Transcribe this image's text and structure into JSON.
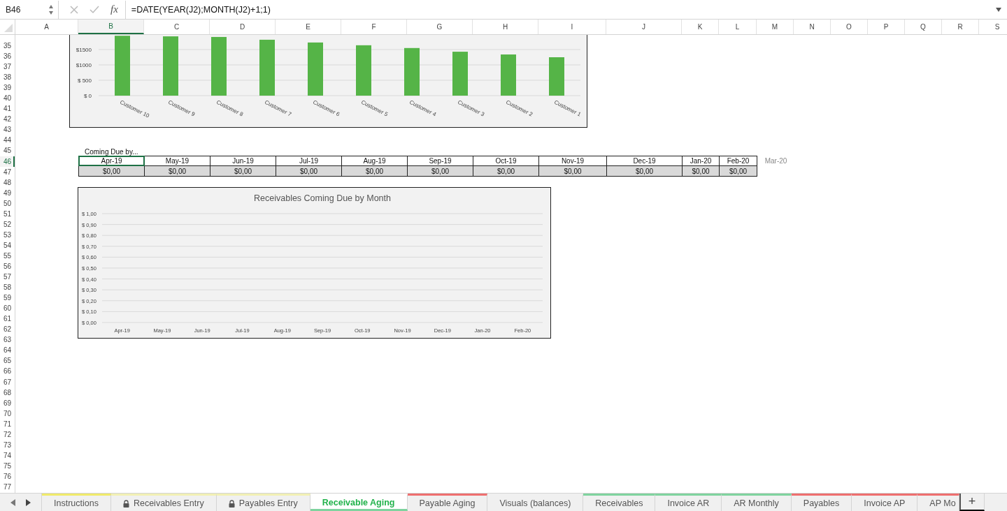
{
  "formula_bar": {
    "name_box": "B46",
    "function_label": "fx",
    "formula": "=DATE(YEAR(J2);MONTH(J2)+1;1)"
  },
  "columns": [
    {
      "label": "A",
      "selected": false
    },
    {
      "label": "B",
      "selected": true
    },
    {
      "label": "C",
      "selected": false
    },
    {
      "label": "D",
      "selected": false
    },
    {
      "label": "E",
      "selected": false
    },
    {
      "label": "F",
      "selected": false
    },
    {
      "label": "G",
      "selected": false
    },
    {
      "label": "H",
      "selected": false
    },
    {
      "label": "I",
      "selected": false
    },
    {
      "label": "J",
      "selected": false
    },
    {
      "label": "K",
      "selected": false
    },
    {
      "label": "L",
      "selected": false
    },
    {
      "label": "M",
      "selected": false
    },
    {
      "label": "N",
      "selected": false
    },
    {
      "label": "O",
      "selected": false
    },
    {
      "label": "P",
      "selected": false
    },
    {
      "label": "Q",
      "selected": false
    },
    {
      "label": "R",
      "selected": false
    },
    {
      "label": "S",
      "selected": false
    }
  ],
  "rows": [
    {
      "label": "35",
      "selected": false
    },
    {
      "label": "36",
      "selected": false
    },
    {
      "label": "37",
      "selected": false
    },
    {
      "label": "38",
      "selected": false
    },
    {
      "label": "39",
      "selected": false
    },
    {
      "label": "40",
      "selected": false
    },
    {
      "label": "41",
      "selected": false
    },
    {
      "label": "42",
      "selected": false
    },
    {
      "label": "43",
      "selected": false
    },
    {
      "label": "44",
      "selected": false
    },
    {
      "label": "45",
      "selected": false
    },
    {
      "label": "46",
      "selected": true
    },
    {
      "label": "47",
      "selected": false
    },
    {
      "label": "48",
      "selected": false
    },
    {
      "label": "49",
      "selected": false
    },
    {
      "label": "50",
      "selected": false
    },
    {
      "label": "51",
      "selected": false
    },
    {
      "label": "52",
      "selected": false
    },
    {
      "label": "53",
      "selected": false
    },
    {
      "label": "54",
      "selected": false
    },
    {
      "label": "55",
      "selected": false
    },
    {
      "label": "56",
      "selected": false
    },
    {
      "label": "57",
      "selected": false
    },
    {
      "label": "58",
      "selected": false
    },
    {
      "label": "59",
      "selected": false
    },
    {
      "label": "60",
      "selected": false
    },
    {
      "label": "61",
      "selected": false
    },
    {
      "label": "62",
      "selected": false
    },
    {
      "label": "63",
      "selected": false
    },
    {
      "label": "64",
      "selected": false
    },
    {
      "label": "65",
      "selected": false
    },
    {
      "label": "66",
      "selected": false
    },
    {
      "label": "67",
      "selected": false
    },
    {
      "label": "68",
      "selected": false
    },
    {
      "label": "69",
      "selected": false
    },
    {
      "label": "70",
      "selected": false
    },
    {
      "label": "71",
      "selected": false
    },
    {
      "label": "72",
      "selected": false
    },
    {
      "label": "73",
      "selected": false
    },
    {
      "label": "74",
      "selected": false
    },
    {
      "label": "75",
      "selected": false
    },
    {
      "label": "76",
      "selected": false
    },
    {
      "label": "77",
      "selected": false
    }
  ],
  "balance_chart": {
    "chart_data": {
      "type": "bar",
      "categories": [
        "Customer 10",
        "Customer 9",
        "Customer 8",
        "Customer 7",
        "Customer 6",
        "Customer 5",
        "Customer 4",
        "Customer 3",
        "Customer 2",
        "Customer 1"
      ],
      "values": [
        1950,
        1930,
        1910,
        1820,
        1730,
        1640,
        1550,
        1430,
        1340,
        1250
      ],
      "ylim": [
        0,
        2000
      ],
      "grid": true,
      "yticks": [
        {
          "value": 0,
          "label": "$ 0"
        },
        {
          "value": 500,
          "label": "$ 500"
        },
        {
          "value": 1000,
          "label": "$1000"
        },
        {
          "value": 1500,
          "label": "$1500"
        }
      ]
    }
  },
  "coming_due": {
    "title": "Coming Due by...",
    "months": [
      {
        "label": "Apr-19",
        "amount": "$0,00",
        "selected": true
      },
      {
        "label": "May-19",
        "amount": "$0,00",
        "selected": false
      },
      {
        "label": "Jun-19",
        "amount": "$0,00",
        "selected": false
      },
      {
        "label": "Jul-19",
        "amount": "$0,00",
        "selected": false
      },
      {
        "label": "Aug-19",
        "amount": "$0,00",
        "selected": false
      },
      {
        "label": "Sep-19",
        "amount": "$0,00",
        "selected": false
      },
      {
        "label": "Oct-19",
        "amount": "$0,00",
        "selected": false
      },
      {
        "label": "Nov-19",
        "amount": "$0,00",
        "selected": false
      },
      {
        "label": "Dec-19",
        "amount": "$0,00",
        "selected": false
      },
      {
        "label": "Jan-20",
        "amount": "$0,00",
        "selected": false
      },
      {
        "label": "Feb-20",
        "amount": "$0,00",
        "selected": false
      }
    ],
    "next_month": "Mar-20"
  },
  "due_chart": {
    "chart_data": {
      "type": "line",
      "title": "Receivables Coming Due by Month",
      "categories": [
        "Apr-19",
        "May-19",
        "Jun-19",
        "Jul-19",
        "Aug-19",
        "Sep-19",
        "Oct-19",
        "Nov-19",
        "Dec-19",
        "Jan-20",
        "Feb-20"
      ],
      "ylim": [
        0,
        1
      ],
      "grid": true,
      "yticks": [
        {
          "value": 0,
          "label": "$ 0,00"
        },
        {
          "value": 0.1,
          "label": "$ 0,10"
        },
        {
          "value": 0.2,
          "label": "$ 0,20"
        },
        {
          "value": 0.3,
          "label": "$ 0,30"
        },
        {
          "value": 0.4,
          "label": "$ 0,40"
        },
        {
          "value": 0.5,
          "label": "$ 0,50"
        },
        {
          "value": 0.6,
          "label": "$ 0,60"
        },
        {
          "value": 0.7,
          "label": "$ 0,70"
        },
        {
          "value": 0.8,
          "label": "$ 0,80"
        },
        {
          "value": 0.9,
          "label": "$ 0,90"
        },
        {
          "value": 1,
          "label": "$ 1,00"
        }
      ]
    }
  },
  "sheet_tabs": [
    {
      "label": "Instructions",
      "selected": false,
      "locked": false,
      "color": "#f0ea6a"
    },
    {
      "label": "Receivables Entry",
      "selected": false,
      "locked": true,
      "color": "#f1f0b4"
    },
    {
      "label": "Payables Entry",
      "selected": false,
      "locked": true,
      "color": "#f1f0b4"
    },
    {
      "label": "Receivable Aging",
      "selected": true,
      "locked": false,
      "color": "#7fd39e"
    },
    {
      "label": "Payable Aging",
      "selected": false,
      "locked": false,
      "color": "#ee6f6f"
    },
    {
      "label": "Visuals (balances)",
      "selected": false,
      "locked": false
    },
    {
      "label": "Receivables",
      "selected": false,
      "locked": false,
      "color": "#7fd39e"
    },
    {
      "label": "Invoice AR",
      "selected": false,
      "locked": false,
      "color": "#7fd39e"
    },
    {
      "label": "AR Monthly",
      "selected": false,
      "locked": false,
      "color": "#7fd39e"
    },
    {
      "label": "Payables",
      "selected": false,
      "locked": false,
      "color": "#ee6f6f"
    },
    {
      "label": "Invoice AP",
      "selected": false,
      "locked": false,
      "color": "#ee6f6f"
    },
    {
      "label": "AP Mo",
      "selected": false,
      "locked": false,
      "color": "#ee6f6f"
    }
  ],
  "add_tab": "+"
}
